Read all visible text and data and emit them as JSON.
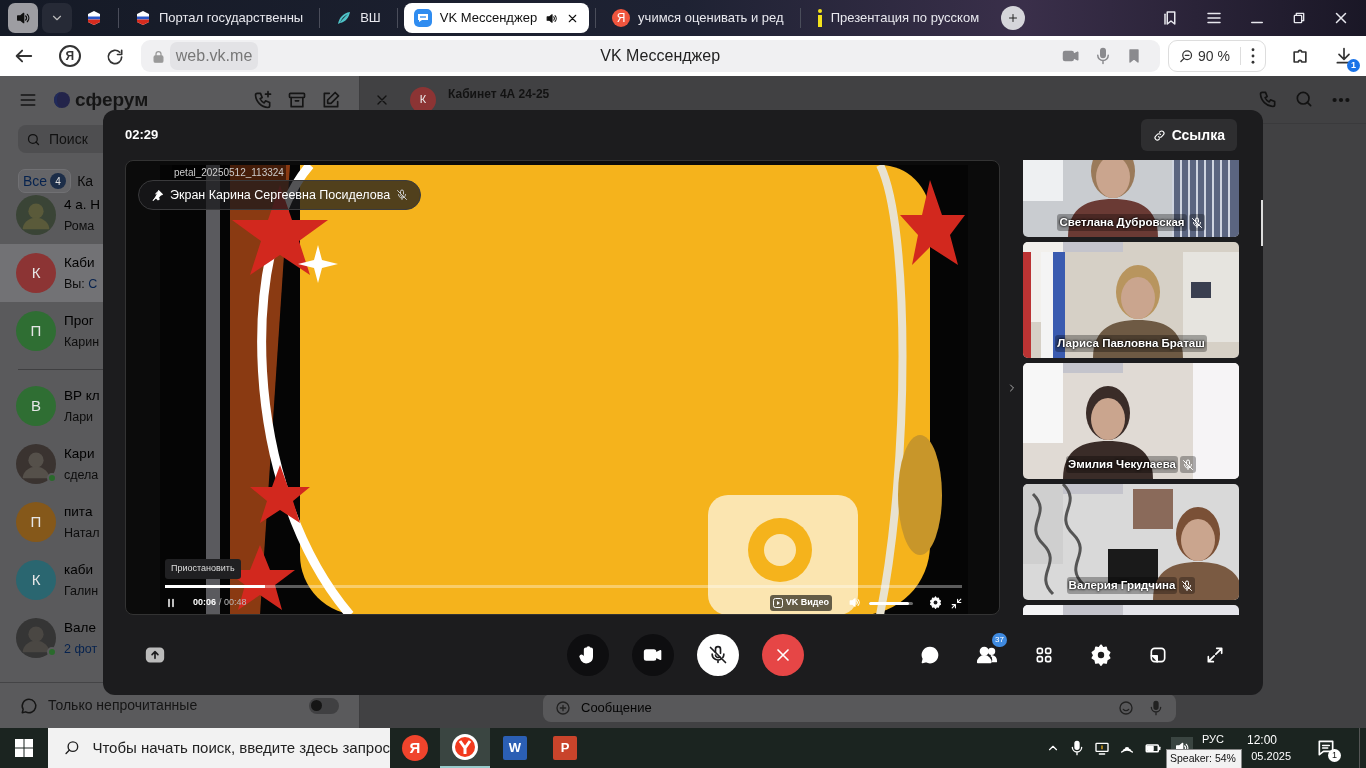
{
  "browser": {
    "tabs": [
      {
        "kind": "flag",
        "selected": false,
        "audio": false
      },
      {
        "kind": "flag",
        "title": "Портал государственны",
        "selected": false,
        "audio": false
      },
      {
        "kind": "feather",
        "title": "ВШ",
        "selected": false,
        "audio": false
      },
      {
        "kind": "messenger",
        "title": "VK Мессенджер",
        "selected": true,
        "audio": true
      },
      {
        "kind": "yandex",
        "icon_letter": "Я",
        "title": "учимся оценивать и ред",
        "selected": false,
        "audio": false
      },
      {
        "kind": "marker",
        "title": "Презентация по русском",
        "selected": false,
        "audio": false
      }
    ],
    "home_letter": "Я",
    "url": "web.vk.me",
    "page_title": "VK Мессенджер",
    "zoom": "90 %",
    "download_count": "1"
  },
  "sidebar": {
    "brand": "сферум",
    "search_placeholder": "Поиск",
    "filters": [
      {
        "label": "Все",
        "count": "4",
        "selected": true
      },
      {
        "label": "Ка",
        "selected": false
      }
    ],
    "pinned_chats": [
      {
        "name": "4 а. Н",
        "preview": "Рома",
        "avatar": {
          "kind": "picture"
        },
        "selected": false,
        "online": false,
        "preview_link": false
      },
      {
        "name": "Каби",
        "author": "Вы:",
        "preview": "С",
        "avatar": {
          "kind": "letter",
          "letter": "К",
          "color": "#8c3434"
        },
        "selected": true,
        "online": false,
        "preview_link": true
      },
      {
        "name": "Прог",
        "preview": "Карин",
        "avatar": {
          "kind": "letter",
          "letter": "П",
          "color": "#2f6e33"
        },
        "selected": false,
        "online": false,
        "preview_link": false
      }
    ],
    "chats": [
      {
        "name": "ВР кл",
        "preview": "Лари",
        "avatar": {
          "kind": "letter",
          "letter": "В",
          "color": "#2f6e33"
        },
        "selected": false,
        "online": false,
        "preview_link": false
      },
      {
        "name": "Кари",
        "preview": "сдела",
        "avatar": {
          "kind": "picture"
        },
        "selected": false,
        "online": true,
        "preview_link": false
      },
      {
        "name": "пита",
        "preview": "Натал",
        "avatar": {
          "kind": "letter",
          "letter": "П",
          "color": "#85581a"
        },
        "selected": false,
        "online": false,
        "preview_link": false
      },
      {
        "name": "каби",
        "preview": "Галин",
        "avatar": {
          "kind": "letter",
          "letter": "К",
          "color": "#2a6670"
        },
        "selected": false,
        "online": false,
        "preview_link": false
      },
      {
        "name": "Вале",
        "preview": "2 фот",
        "avatar": {
          "kind": "picture"
        },
        "selected": false,
        "online": true,
        "preview_link": true
      }
    ],
    "unread_only": {
      "label": "Только непрочитанные",
      "on": false
    }
  },
  "chat": {
    "title": "Кабинет 4А 24-25",
    "avatar_letter": "К",
    "message_placeholder": "Сообщение"
  },
  "call": {
    "timer": "02:29",
    "link_button": "Ссылка",
    "stage": {
      "source_label": "Экран Карина Сергеевна Посиделова",
      "muted": true,
      "file_name": "petal_20250512_113324",
      "player": {
        "tooltip": "Приостановить",
        "playing": true,
        "level": 0.125,
        "current": "00:06",
        "duration": "/ 00:48",
        "brand": "VK Видео",
        "volume": {
          "level": 0.9
        }
      }
    },
    "participants": [
      {
        "name": "Светлана Дубровская",
        "muted": true
      },
      {
        "name": "Лариса Павловна Браташ",
        "muted": false
      },
      {
        "name": "Эмилия Чекулаева",
        "muted": true
      },
      {
        "name": "Валерия Гридчина",
        "muted": true
      },
      {
        "kind": "picture"
      }
    ],
    "controls": {
      "hand_raised": false,
      "camera_on": true,
      "mic_muted": true,
      "participants_count": "37"
    }
  },
  "taskbar": {
    "search_placeholder": "Чтобы начать поиск, введите здесь запрос",
    "apps": [
      {
        "kind": "yandex",
        "letter": "Я",
        "selected": false
      },
      {
        "kind": "browser",
        "selected": true
      },
      {
        "kind": "word",
        "letter": "W",
        "selected": false
      },
      {
        "kind": "powerpoint",
        "letter": "P",
        "selected": false
      }
    ],
    "language": "РУС",
    "time": "12:00",
    "date": "05.2025",
    "tooltip": "Speaker: 54%",
    "notifications": "1"
  }
}
